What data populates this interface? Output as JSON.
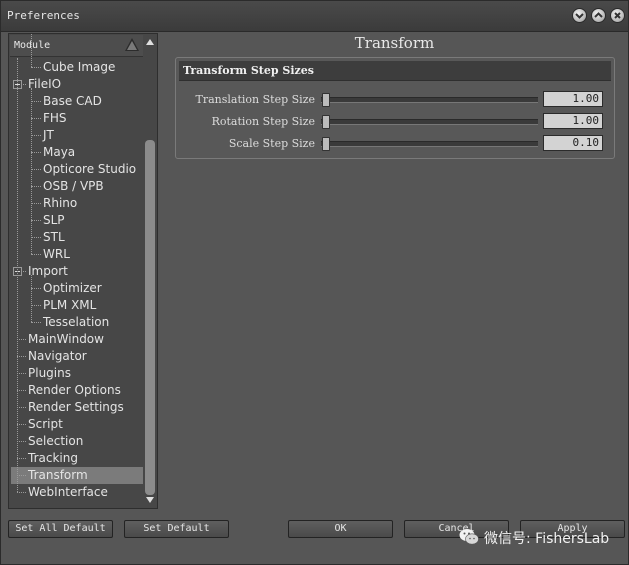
{
  "window": {
    "title": "Preferences"
  },
  "tree": {
    "header": "Module",
    "items": [
      {
        "label": "Cube Image",
        "level": 2,
        "selected": false
      },
      {
        "label": "FileIO",
        "level": 1,
        "expanded": true,
        "selected": false
      },
      {
        "label": "Base CAD",
        "level": 2,
        "selected": false
      },
      {
        "label": "FHS",
        "level": 2,
        "selected": false
      },
      {
        "label": "JT",
        "level": 2,
        "selected": false
      },
      {
        "label": "Maya",
        "level": 2,
        "selected": false
      },
      {
        "label": "Opticore Studio",
        "level": 2,
        "selected": false
      },
      {
        "label": "OSB / VPB",
        "level": 2,
        "selected": false
      },
      {
        "label": "Rhino",
        "level": 2,
        "selected": false
      },
      {
        "label": "SLP",
        "level": 2,
        "selected": false
      },
      {
        "label": "STL",
        "level": 2,
        "selected": false
      },
      {
        "label": "WRL",
        "level": 2,
        "selected": false
      },
      {
        "label": "Import",
        "level": 1,
        "expanded": true,
        "selected": false
      },
      {
        "label": "Optimizer",
        "level": 2,
        "selected": false
      },
      {
        "label": "PLM XML",
        "level": 2,
        "selected": false
      },
      {
        "label": "Tesselation",
        "level": 2,
        "selected": false
      },
      {
        "label": "MainWindow",
        "level": 1,
        "selected": false
      },
      {
        "label": "Navigator",
        "level": 1,
        "selected": false
      },
      {
        "label": "Plugins",
        "level": 1,
        "selected": false
      },
      {
        "label": "Render Options",
        "level": 1,
        "selected": false
      },
      {
        "label": "Render Settings",
        "level": 1,
        "selected": false
      },
      {
        "label": "Script",
        "level": 1,
        "selected": false
      },
      {
        "label": "Selection",
        "level": 1,
        "selected": false
      },
      {
        "label": "Tracking",
        "level": 1,
        "selected": false
      },
      {
        "label": "Transform",
        "level": 1,
        "selected": true
      },
      {
        "label": "WebInterface",
        "level": 1,
        "selected": false
      }
    ]
  },
  "panel": {
    "title": "Transform",
    "group_title": "Transform Step Sizes",
    "rows": [
      {
        "label": "Translation Step Size",
        "value": "1.00",
        "slider_fraction": 0.0
      },
      {
        "label": "Rotation Step Size",
        "value": "1.00",
        "slider_fraction": 0.0
      },
      {
        "label": "Scale Step Size",
        "value": "0.10",
        "slider_fraction": 0.0
      }
    ]
  },
  "buttons": {
    "set_all_default": "Set All Default",
    "set_default": "Set Default",
    "ok": "OK",
    "cancel": "Cancel",
    "apply": "Apply"
  },
  "watermark": {
    "text": "微信号: FishersLab"
  }
}
